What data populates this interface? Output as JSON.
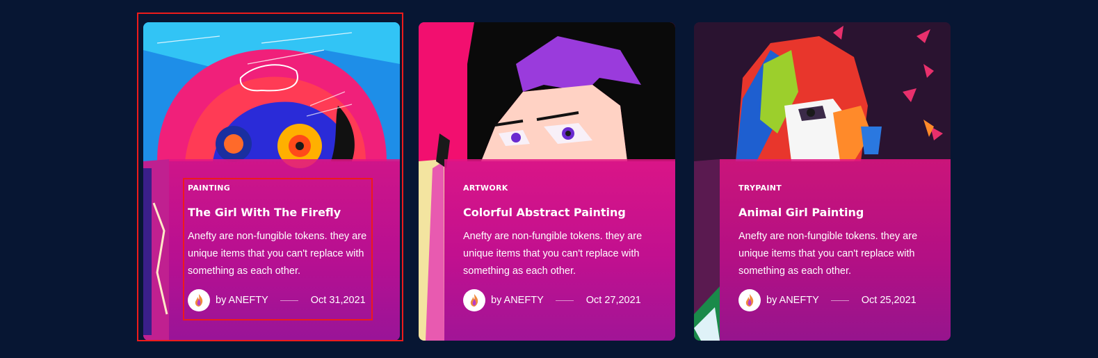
{
  "posts": [
    {
      "image": "painting-image",
      "category": "PAINTING",
      "title": "The Girl With The Firefly",
      "excerpt": "Anefty are non-fungible tokens. they are unique items that you can't replace with something as each other.",
      "author": "by ANEFTY",
      "date": "Oct 31,2021"
    },
    {
      "image": "artwork-image",
      "category": "ARTWORK",
      "title": "Colorful Abstract Painting",
      "excerpt": "Anefty are non-fungible tokens. they are unique items that you can't replace with something as each other.",
      "author": "by ANEFTY",
      "date": "Oct 27,2021"
    },
    {
      "image": "trypaint-image",
      "category": "TRYPAINT",
      "title": "Animal Girl Painting",
      "excerpt": "Anefty are non-fungible tokens. they are unique items that you can't replace with something as each other.",
      "author": "by ANEFTY",
      "date": "Oct 25,2021"
    }
  ],
  "colors": {
    "background": "#071633",
    "overlay": "#e21484",
    "highlight": "#ee1b1b"
  }
}
